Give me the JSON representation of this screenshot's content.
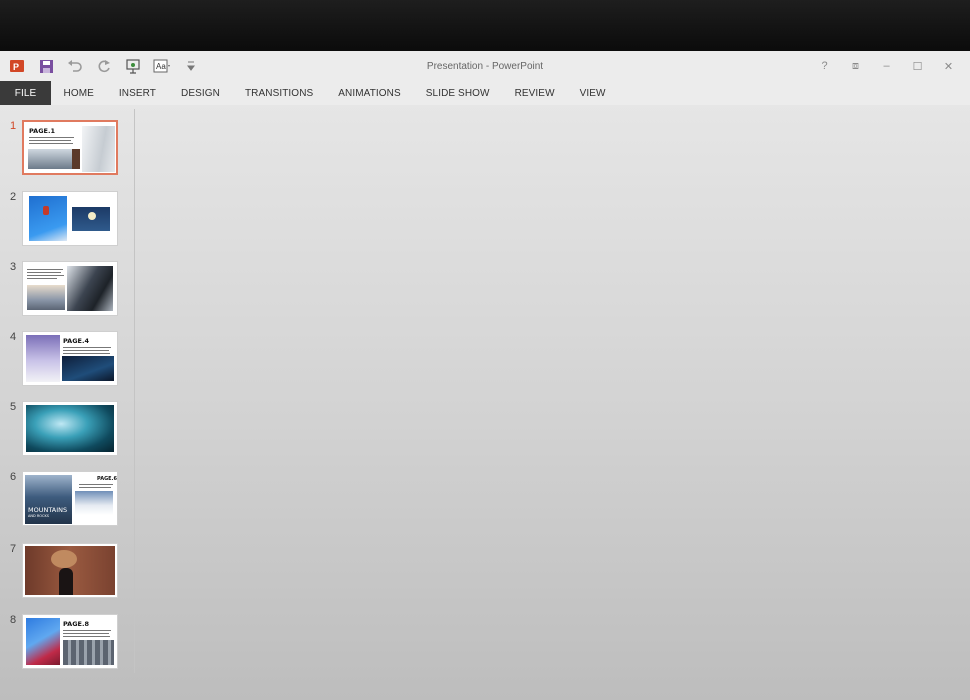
{
  "window": {
    "title": "Presentation - PowerPoint"
  },
  "quick_access": [
    {
      "name": "powerpoint-logo-icon"
    },
    {
      "name": "save-icon"
    },
    {
      "name": "undo-icon"
    },
    {
      "name": "redo-icon"
    },
    {
      "name": "start-from-beginning-icon"
    },
    {
      "name": "font-size-icon"
    },
    {
      "name": "customize-dropdown-icon"
    }
  ],
  "window_controls": {
    "help": "?",
    "restore_ribbon": "⧈",
    "minimize": "–",
    "maximize": "☐",
    "close": "✕"
  },
  "ribbon": {
    "tabs": [
      "FILE",
      "HOME",
      "INSERT",
      "DESIGN",
      "TRANSITIONS",
      "ANIMATIONS",
      "SLIDE SHOW",
      "REVIEW",
      "VIEW"
    ]
  },
  "slides": [
    {
      "number": "1",
      "heading": "PAGE.1",
      "active": true
    },
    {
      "number": "2",
      "heading": ""
    },
    {
      "number": "3",
      "heading": ""
    },
    {
      "number": "4",
      "heading": "PAGE.4"
    },
    {
      "number": "5",
      "heading": ""
    },
    {
      "number": "6",
      "heading": "PAGE.6",
      "caption": "MOUNTAINS",
      "subcaption": "AND ROCKS"
    },
    {
      "number": "7",
      "heading": ""
    },
    {
      "number": "8",
      "heading": "PAGE.8"
    }
  ],
  "colors": {
    "accent": "#d24726",
    "file_tab": "#3a3a3a"
  }
}
